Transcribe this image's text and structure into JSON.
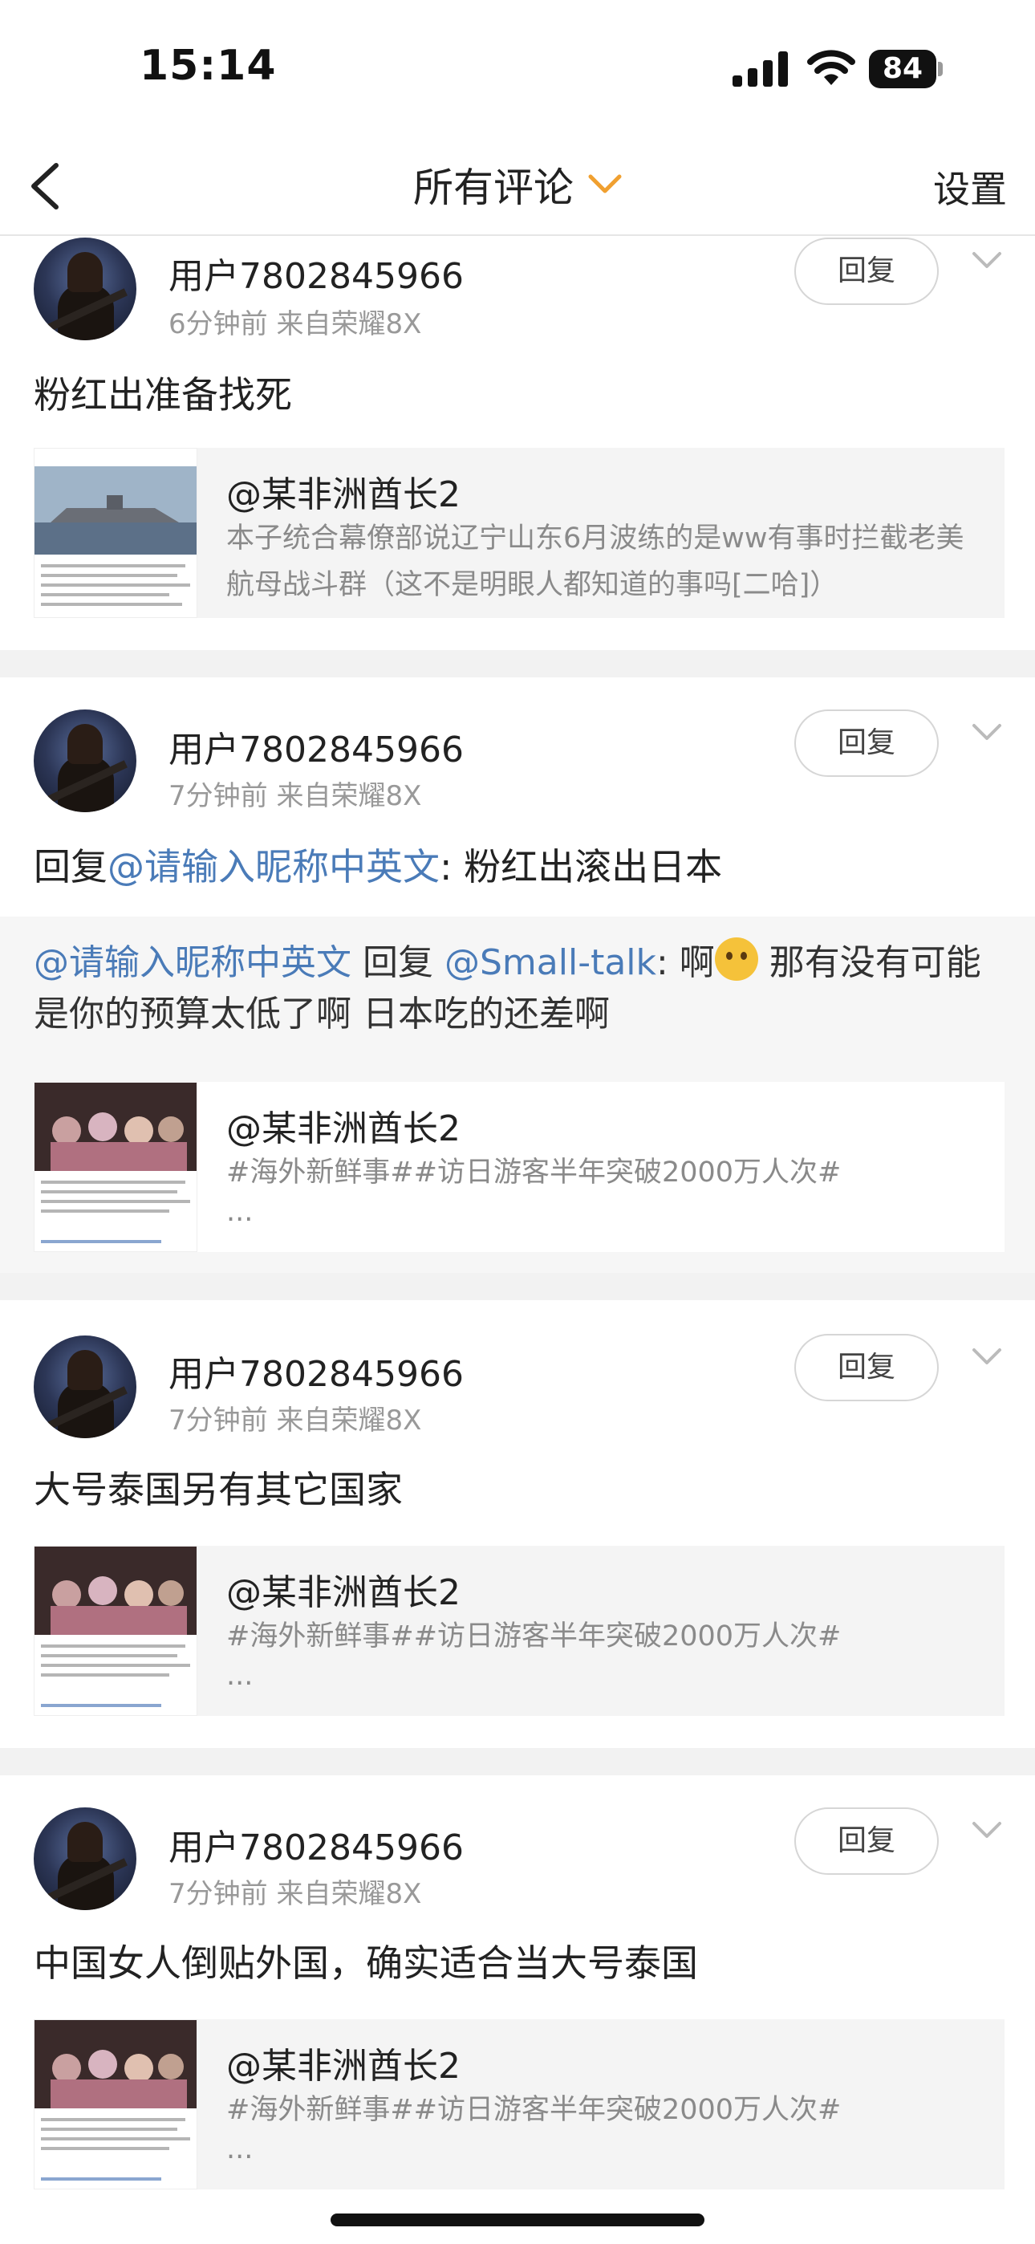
{
  "status_bar": {
    "time": "15:14",
    "battery": "84"
  },
  "nav": {
    "title": "所有评论",
    "settings": "设置"
  },
  "comments": [
    {
      "user": "用户7802845966",
      "meta": "6分钟前  来自荣耀8X",
      "reply_label": "回复",
      "text": "粉红出准备找死",
      "link": {
        "author": "@某非洲酋长2",
        "desc": "本子统合幕僚部说辽宁山东6月波练的是ww有事时拦截老美航母战斗群（这不是明眼人都知道的事吗[二哈]）"
      }
    },
    {
      "user": "用户7802845966",
      "meta": "7分钟前  来自荣耀8X",
      "reply_label": "回复",
      "text_prefix": "回复",
      "text_mention": "@请输入昵称中英文",
      "text_suffix": ": 粉红出滚出日本",
      "quote": {
        "mention1": "@请输入昵称中英文",
        "reply_word": " 回复 ",
        "mention2": "@Small-talk",
        "text_before_emoji": ": 啊",
        "text_after_emoji": " 那有没有可能是你的预算太低了啊 日本吃的还差啊"
      },
      "link": {
        "author": "@某非洲酋长2",
        "desc": "#海外新鲜事##访日游客半年突破2000万人次#",
        "more": "..."
      }
    },
    {
      "user": "用户7802845966",
      "meta": "7分钟前  来自荣耀8X",
      "reply_label": "回复",
      "text": "大号泰国另有其它国家",
      "link": {
        "author": "@某非洲酋长2",
        "desc": "#海外新鲜事##访日游客半年突破2000万人次#",
        "more": "..."
      }
    },
    {
      "user": "用户7802845966",
      "meta": "7分钟前  来自荣耀8X",
      "reply_label": "回复",
      "text": "中国女人倒贴外国，确实适合当大号泰国",
      "link": {
        "author": "@某非洲酋长2",
        "desc": "#海外新鲜事##访日游客半年突破2000万人次#",
        "more": "..."
      }
    }
  ],
  "colors": {
    "accent": "#f0a030",
    "mention": "#4a7bb8",
    "muted": "#999999",
    "separator": "#f2f2f2"
  },
  "icons": [
    "back-icon",
    "chevron-down-icon",
    "signal-icon",
    "wifi-icon",
    "battery-icon",
    "more-chevron-icon"
  ]
}
